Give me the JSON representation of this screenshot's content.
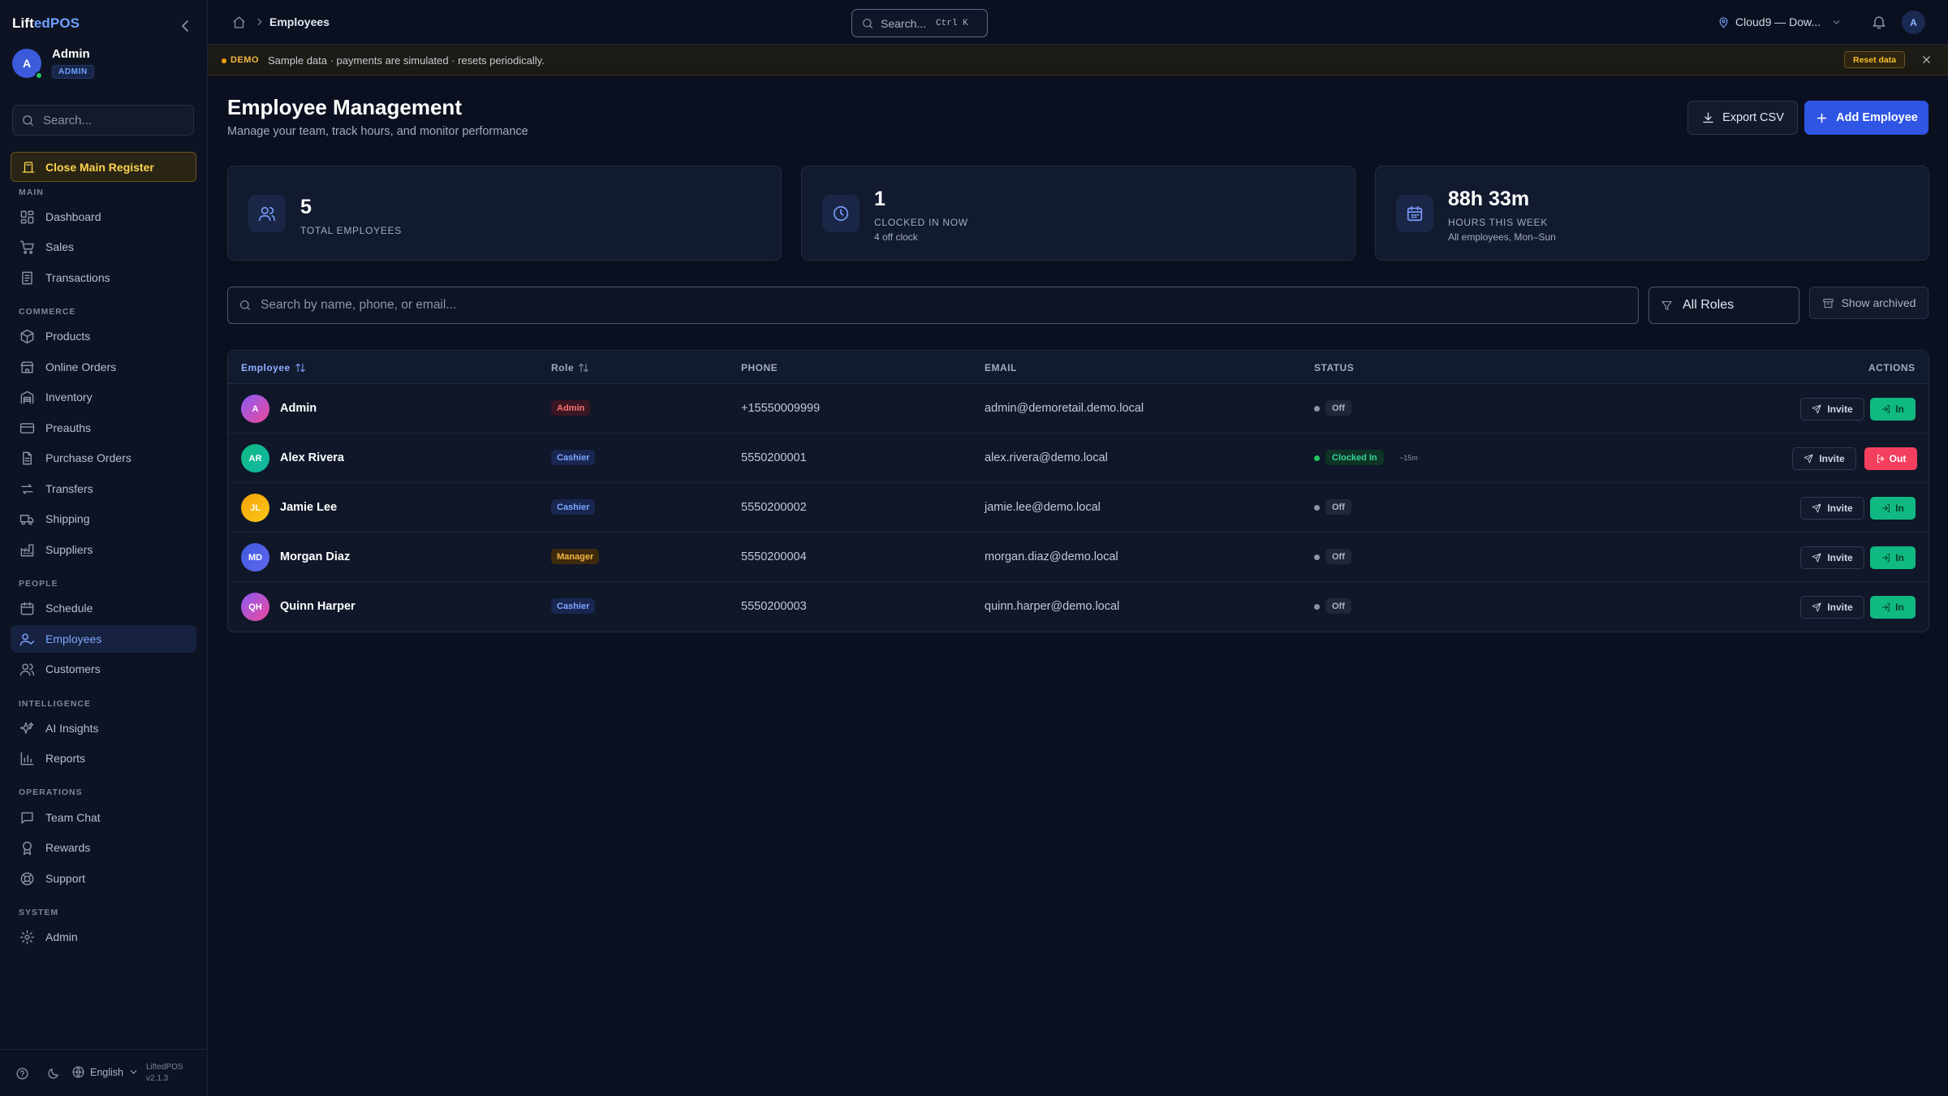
{
  "app": {
    "brand_a": "Lift",
    "brand_b": "edPOS"
  },
  "user": {
    "name": "Admin",
    "initial": "A",
    "role": "ADMIN"
  },
  "sidebar": {
    "search_placeholder": "Search...",
    "register_button": "Close Main Register",
    "sections": [
      {
        "title": "MAIN",
        "items": [
          {
            "label": "Dashboard",
            "icon": "dashboard-icon"
          },
          {
            "label": "Sales",
            "icon": "cart-icon"
          },
          {
            "label": "Transactions",
            "icon": "receipt-icon"
          }
        ]
      },
      {
        "title": "COMMERCE",
        "items": [
          {
            "label": "Products",
            "icon": "box-icon"
          },
          {
            "label": "Online Orders",
            "icon": "store-icon"
          },
          {
            "label": "Inventory",
            "icon": "warehouse-icon"
          },
          {
            "label": "Preauths",
            "icon": "credit-card-icon"
          },
          {
            "label": "Purchase Orders",
            "icon": "document-icon"
          },
          {
            "label": "Transfers",
            "icon": "transfer-icon"
          },
          {
            "label": "Shipping",
            "icon": "truck-icon"
          },
          {
            "label": "Suppliers",
            "icon": "factory-icon"
          }
        ]
      },
      {
        "title": "PEOPLE",
        "items": [
          {
            "label": "Schedule",
            "icon": "calendar-icon"
          },
          {
            "label": "Employees",
            "icon": "user-check-icon",
            "active": true
          },
          {
            "label": "Customers",
            "icon": "users-icon"
          }
        ]
      },
      {
        "title": "INTELLIGENCE",
        "items": [
          {
            "label": "AI Insights",
            "icon": "sparkles-icon"
          },
          {
            "label": "Reports",
            "icon": "bar-chart-icon"
          }
        ]
      },
      {
        "title": "OPERATIONS",
        "items": [
          {
            "label": "Team Chat",
            "icon": "chat-icon"
          },
          {
            "label": "Rewards",
            "icon": "award-icon"
          },
          {
            "label": "Support",
            "icon": "lifebuoy-icon"
          }
        ]
      },
      {
        "title": "SYSTEM",
        "items": [
          {
            "label": "Admin",
            "icon": "gear-icon"
          }
        ]
      }
    ],
    "footer": {
      "language": "English",
      "app_name": "LiftedPOS",
      "version": "v2.1.3"
    }
  },
  "topbar": {
    "breadcrumb": "Employees",
    "search_label": "Search...",
    "search_shortcut": "Ctrl K",
    "location": "Cloud9 — Dow..."
  },
  "banner": {
    "tag": "DEMO",
    "text": "Sample data · payments are simulated · resets periodically.",
    "reset_label": "Reset data"
  },
  "page": {
    "title": "Employee Management",
    "subtitle": "Manage your team, track hours, and monitor performance",
    "export_label": "Export CSV",
    "add_label": "Add Employee"
  },
  "stats": [
    {
      "value": "5",
      "label": "TOTAL EMPLOYEES",
      "sub": ""
    },
    {
      "value": "1",
      "label": "CLOCKED IN NOW",
      "sub": "4 off clock"
    },
    {
      "value": "88h 33m",
      "label": "HOURS THIS WEEK",
      "sub": "All employees, Mon–Sun"
    }
  ],
  "filters": {
    "search_placeholder": "Search by name, phone, or email...",
    "role_select": "All Roles",
    "archived_label": "Show archived"
  },
  "table": {
    "columns": {
      "employee": "Employee",
      "role": "Role",
      "phone": "PHONE",
      "email": "EMAIL",
      "status": "STATUS",
      "actions": "ACTIONS"
    },
    "invite_label": "Invite",
    "in_label": "In",
    "out_label": "Out",
    "rows": [
      {
        "initials": "A",
        "name": "Admin",
        "role": "Admin",
        "phone": "+15550009999",
        "email": "admin@demoretail.demo.local",
        "status": "Off",
        "since": ""
      },
      {
        "initials": "AR",
        "name": "Alex Rivera",
        "role": "Cashier",
        "phone": "5550200001",
        "email": "alex.rivera@demo.local",
        "status": "Clocked In",
        "since": "~15m"
      },
      {
        "initials": "JL",
        "name": "Jamie Lee",
        "role": "Cashier",
        "phone": "5550200002",
        "email": "jamie.lee@demo.local",
        "status": "Off",
        "since": ""
      },
      {
        "initials": "MD",
        "name": "Morgan Diaz",
        "role": "Manager",
        "phone": "5550200004",
        "email": "morgan.diaz@demo.local",
        "status": "Off",
        "since": ""
      },
      {
        "initials": "QH",
        "name": "Quinn Harper",
        "role": "Cashier",
        "phone": "5550200003",
        "email": "quinn.harper@demo.local",
        "status": "Off",
        "since": ""
      }
    ]
  },
  "colors": {
    "accent": "#2f55e4",
    "success": "#10b981",
    "danger": "#f43f5e",
    "warning": "#f5b642"
  }
}
